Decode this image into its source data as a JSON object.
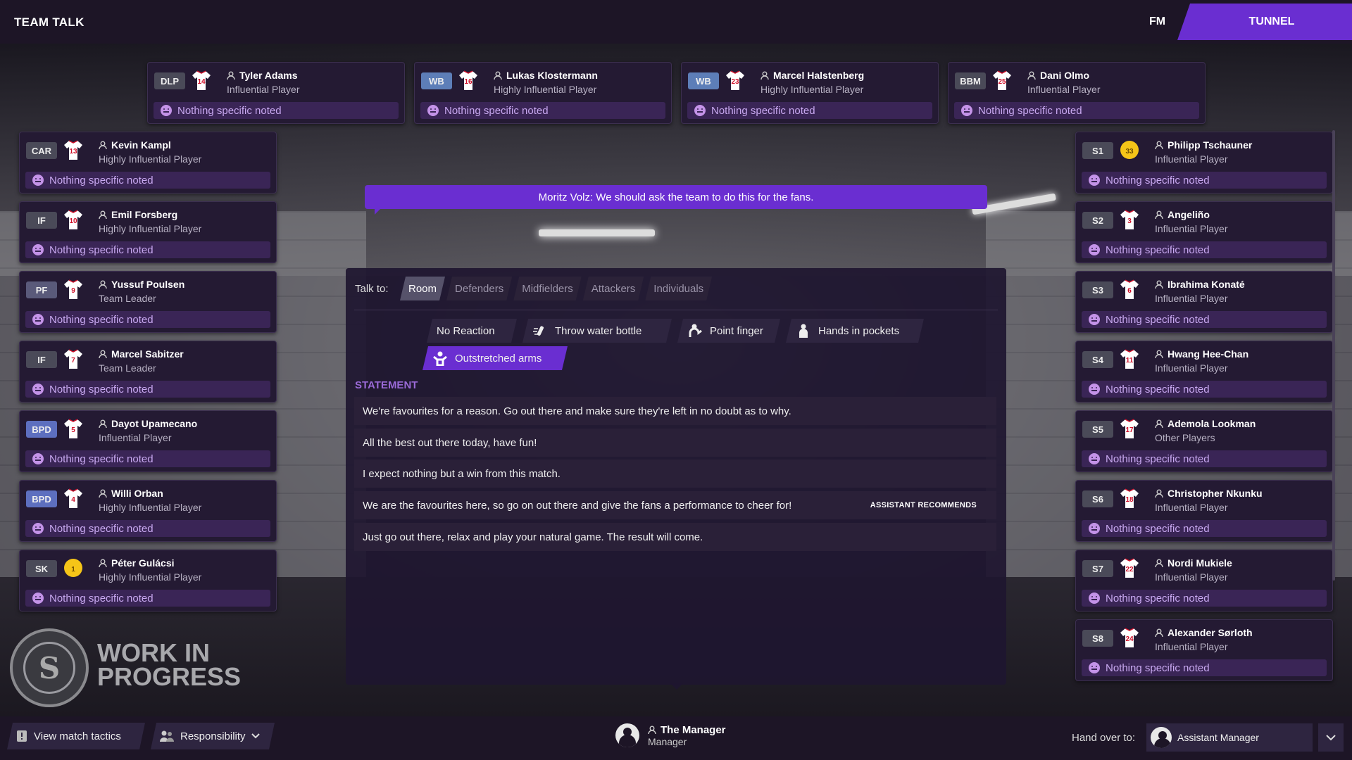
{
  "header": {
    "title": "TEAM TALK",
    "fm_label": "FM",
    "tunnel_label": "TUNNEL"
  },
  "speech": "Moritz Volz: We should ask the team to do this for the fans.",
  "mood_text": "Nothing specific noted",
  "top_players": [
    {
      "pos": "DLP",
      "number": "14",
      "name": "Tyler Adams",
      "role": "Influential Player",
      "mood": "Nothing specific noted"
    },
    {
      "pos": "WB",
      "number": "16",
      "name": "Lukas Klostermann",
      "role": "Highly Influential Player",
      "mood": "Nothing specific noted"
    },
    {
      "pos": "WB",
      "number": "23",
      "name": "Marcel Halstenberg",
      "role": "Highly Influential Player",
      "mood": "Nothing specific noted"
    },
    {
      "pos": "BBM",
      "number": "25",
      "name": "Dani Olmo",
      "role": "Influential Player",
      "mood": "Nothing specific noted"
    }
  ],
  "left_players": [
    {
      "pos": "CAR",
      "number": "13",
      "name": "Kevin Kampl",
      "role": "Highly Influential Player",
      "mood": "Nothing specific noted"
    },
    {
      "pos": "IF",
      "number": "10",
      "name": "Emil Forsberg",
      "role": "Highly Influential Player",
      "mood": "Nothing specific noted"
    },
    {
      "pos": "PF",
      "number": "9",
      "name": "Yussuf Poulsen",
      "role": "Team Leader",
      "mood": "Nothing specific noted"
    },
    {
      "pos": "IF",
      "number": "7",
      "name": "Marcel Sabitzer",
      "role": "Team Leader",
      "mood": "Nothing specific noted"
    },
    {
      "pos": "BPD",
      "number": "5",
      "name": "Dayot Upamecano",
      "role": "Influential Player",
      "mood": "Nothing specific noted"
    },
    {
      "pos": "BPD",
      "number": "4",
      "name": "Willi Orban",
      "role": "Highly Influential Player",
      "mood": "Nothing specific noted"
    },
    {
      "pos": "SK",
      "number": "1",
      "name": "Péter Gulácsi",
      "role": "Highly Influential Player",
      "mood": "Nothing specific noted"
    }
  ],
  "right_players": [
    {
      "pos": "S1",
      "number": "33",
      "name": "Philipp Tschauner",
      "role": "Influential Player",
      "mood": "Nothing specific noted"
    },
    {
      "pos": "S2",
      "number": "3",
      "name": "Angeliño",
      "role": "Influential Player",
      "mood": "Nothing specific noted"
    },
    {
      "pos": "S3",
      "number": "6",
      "name": "Ibrahima Konaté",
      "role": "Influential Player",
      "mood": "Nothing specific noted"
    },
    {
      "pos": "S4",
      "number": "11",
      "name": "Hwang Hee-Chan",
      "role": "Influential Player",
      "mood": "Nothing specific noted"
    },
    {
      "pos": "S5",
      "number": "17",
      "name": "Ademola Lookman",
      "role": "Other Players",
      "mood": "Nothing specific noted"
    },
    {
      "pos": "S6",
      "number": "18",
      "name": "Christopher Nkunku",
      "role": "Influential Player",
      "mood": "Nothing specific noted"
    },
    {
      "pos": "S7",
      "number": "22",
      "name": "Nordi Mukiele",
      "role": "Influential Player",
      "mood": "Nothing specific noted"
    },
    {
      "pos": "S8",
      "number": "24",
      "name": "Alexander Sørloth",
      "role": "Influential Player",
      "mood": "Nothing specific noted"
    }
  ],
  "talk": {
    "label": "Talk to:",
    "tabs": [
      "Room",
      "Defenders",
      "Midfielders",
      "Attackers",
      "Individuals"
    ],
    "active_tab": "Room",
    "gestures": [
      "No Reaction",
      "Throw water bottle",
      "Point finger",
      "Hands in pockets",
      "Outstretched arms"
    ],
    "selected_gesture": "Outstretched arms",
    "statement_heading": "STATEMENT",
    "statements": [
      "We're favourites for a reason. Go out there and make sure they're left in no doubt as to why.",
      "All the best out there today, have fun!",
      "I expect nothing but a win from this match.",
      "We are the favourites here, so go on out there and give the fans a performance to cheer for!",
      "Just go out there, relax and play your natural game. The result will come."
    ],
    "recommend_label": "ASSISTANT RECOMMENDS"
  },
  "watermark": {
    "line1": "WORK IN",
    "line2": "PROGRESS"
  },
  "footer": {
    "view_tactics": "View match tactics",
    "responsibility": "Responsibility",
    "manager_name": "The Manager",
    "manager_role": "Manager",
    "hand_over": "Hand over to:",
    "assistant_role": "Assistant Manager"
  },
  "colors": {
    "accent": "#6a2ed1",
    "panel": "#241a33",
    "mood": "#c493e8",
    "gk_shirt": "#f5c518",
    "shirt": "#ffffff",
    "shirt_trim": "#d0102a"
  }
}
